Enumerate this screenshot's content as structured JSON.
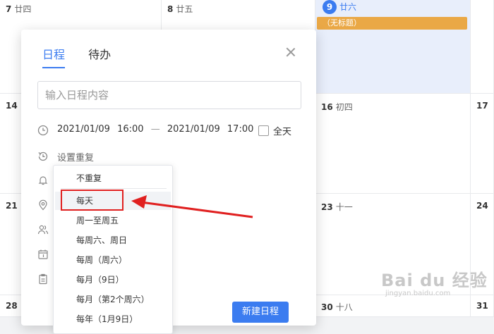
{
  "calendar": {
    "cells": [
      {
        "num": "7",
        "lunar": "廿四"
      },
      {
        "num": "8",
        "lunar": "廿五"
      },
      {
        "num": "9",
        "lunar": "廿六"
      },
      {
        "num": "14",
        "lunar": ""
      },
      {
        "num": "16",
        "lunar": "初四"
      },
      {
        "num": "17",
        "lunar": ""
      },
      {
        "num": "21",
        "lunar": ""
      },
      {
        "num": "23",
        "lunar": "十一"
      },
      {
        "num": "24",
        "lunar": ""
      },
      {
        "num": "28",
        "lunar": ""
      },
      {
        "num": "30",
        "lunar": "十八"
      },
      {
        "num": "31",
        "lunar": ""
      }
    ],
    "event_label": "（无标题）"
  },
  "modal": {
    "tabs": [
      {
        "label": "日程",
        "active": true
      },
      {
        "label": "待办",
        "active": false
      }
    ],
    "content_placeholder": "输入日程内容",
    "start_date": "2021/01/09",
    "start_time": "16:00",
    "dash": "—",
    "end_date": "2021/01/09",
    "end_time": "17:00",
    "allday_label": "全天",
    "repeat_label": "设置重复",
    "new_button": "新建日程"
  },
  "dropdown": {
    "items": [
      "不重复",
      "每天",
      "周一至周五",
      "每周六、周日",
      "每周（周六）",
      "每月（9日）",
      "每月（第2个周六）",
      "每年（1月9日）"
    ],
    "selected_index": 1
  },
  "watermark": {
    "logo": "Bai du 经验",
    "sub": "jingyan.baidu.com"
  },
  "colors": {
    "accent": "#3b7cf0",
    "event": "#eaa846",
    "annotation": "#e02020"
  }
}
